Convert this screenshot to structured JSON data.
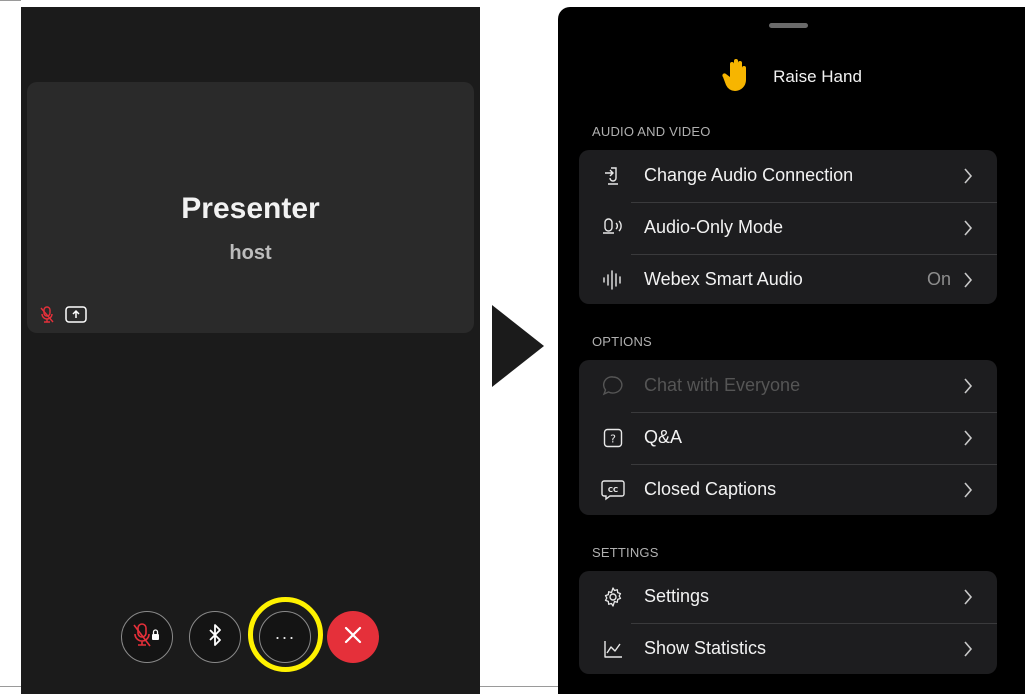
{
  "left_screen": {
    "presenter_name": "Presenter",
    "presenter_role": "host",
    "tile_icons": [
      "muted-mic-icon",
      "share-screen-icon"
    ],
    "controls": [
      {
        "name": "mute-locked-button",
        "icon": "muted-mic-lock-icon"
      },
      {
        "name": "bluetooth-button",
        "icon": "bluetooth-icon"
      },
      {
        "name": "more-options-button",
        "label": "···"
      },
      {
        "name": "end-call-button",
        "icon": "close-icon"
      }
    ],
    "highlight_color": "#fff200"
  },
  "right_screen": {
    "raise_hand": {
      "label": "Raise Hand",
      "icon": "raised-hand-icon"
    },
    "sections": [
      {
        "title": "AUDIO AND VIDEO",
        "items": [
          {
            "label": "Change Audio Connection",
            "icon": "audio-connection-icon",
            "value": ""
          },
          {
            "label": "Audio-Only Mode",
            "icon": "audio-only-icon",
            "value": ""
          },
          {
            "label": "Webex Smart Audio",
            "icon": "waveform-icon",
            "value": "On"
          }
        ]
      },
      {
        "title": "OPTIONS",
        "items": [
          {
            "label": "Chat with Everyone",
            "icon": "chat-bubble-icon",
            "disabled": true
          },
          {
            "label": "Q&A",
            "icon": "question-icon"
          },
          {
            "label": "Closed Captions",
            "icon": "captions-icon"
          }
        ]
      },
      {
        "title": "SETTINGS",
        "items": [
          {
            "label": "Settings",
            "icon": "gear-icon"
          },
          {
            "label": "Show Statistics",
            "icon": "statistics-icon"
          }
        ]
      }
    ]
  },
  "colors": {
    "end_call": "#e5303a",
    "muted_mic": "#e5303a",
    "raise_hand": "#f7b500"
  }
}
